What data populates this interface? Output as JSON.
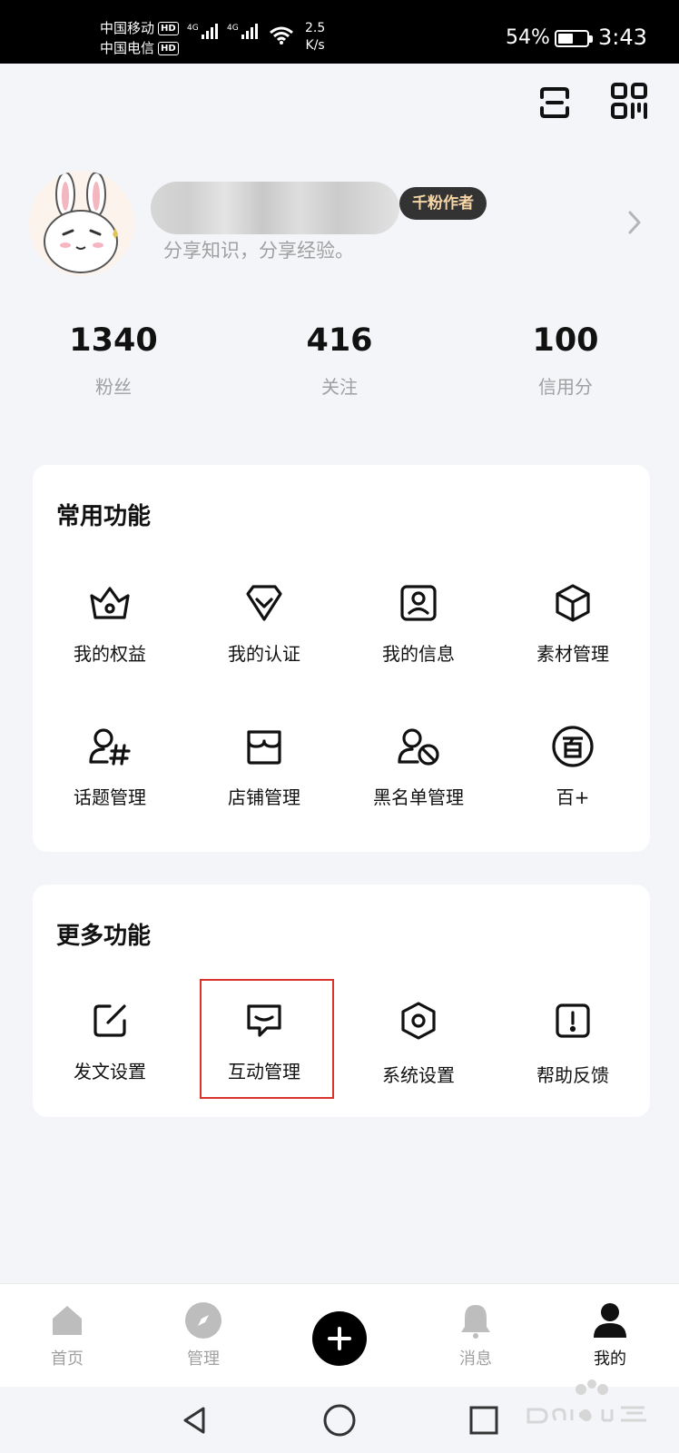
{
  "status_bar": {
    "carrier1": "中国移动",
    "carrier2": "中国电信",
    "hd": "HD",
    "net_tag": "4G",
    "speed_value": "2.5",
    "speed_unit": "K/s",
    "battery_percent": "54%",
    "battery_level": 0.54,
    "time": "3:43"
  },
  "top_actions": {
    "scan_icon": "scan-icon",
    "qrcode_icon": "qrcode-icon"
  },
  "profile": {
    "badge": "千粉作者",
    "bio": "分享知识，分享经验。"
  },
  "stats": [
    {
      "value": "1340",
      "label": "粉丝"
    },
    {
      "value": "416",
      "label": "关注"
    },
    {
      "value": "100",
      "label": "信用分"
    }
  ],
  "common": {
    "title": "常用功能",
    "items": [
      {
        "label": "我的权益",
        "icon": "crown-icon"
      },
      {
        "label": "我的认证",
        "icon": "verify-icon"
      },
      {
        "label": "我的信息",
        "icon": "profile-card-icon"
      },
      {
        "label": "素材管理",
        "icon": "cube-icon"
      },
      {
        "label": "话题管理",
        "icon": "topic-icon"
      },
      {
        "label": "店铺管理",
        "icon": "shop-icon"
      },
      {
        "label": "黑名单管理",
        "icon": "block-user-icon"
      },
      {
        "label": "百+",
        "icon": "bai-plus-icon"
      }
    ]
  },
  "more": {
    "title": "更多功能",
    "items": [
      {
        "label": "发文设置",
        "icon": "edit-icon"
      },
      {
        "label": "互动管理",
        "icon": "chat-icon"
      },
      {
        "label": "系统设置",
        "icon": "settings-icon"
      },
      {
        "label": "帮助反馈",
        "icon": "feedback-icon"
      }
    ]
  },
  "bottom_nav": {
    "items": [
      {
        "label": "首页",
        "icon": "home-icon"
      },
      {
        "label": "管理",
        "icon": "compass-icon"
      },
      {
        "label": "",
        "icon": "plus-icon"
      },
      {
        "label": "消息",
        "icon": "bell-icon"
      },
      {
        "label": "我的",
        "icon": "user-icon"
      }
    ],
    "active_index": 4
  },
  "colors": {
    "accent": "#000000",
    "highlight": "#d9342b",
    "badge_bg": "#333333",
    "badge_text": "#f6d6a6"
  }
}
